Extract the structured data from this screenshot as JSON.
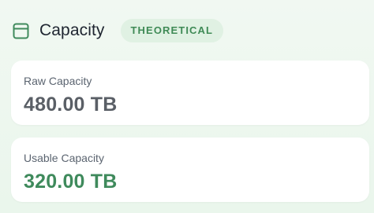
{
  "header": {
    "title": "Capacity",
    "badge": "THEORETICAL"
  },
  "cards": {
    "raw": {
      "label": "Raw Capacity",
      "value": "480.00 TB"
    },
    "usable": {
      "label": "Usable Capacity",
      "value": "320.00 TB"
    }
  },
  "colors": {
    "accent_green": "#3f8a5c",
    "badge_bg": "#e0f1e3",
    "raw_value": "#5a5f66",
    "background": "#eef7ef"
  },
  "icons": {
    "header": "panel-layout-icon"
  }
}
